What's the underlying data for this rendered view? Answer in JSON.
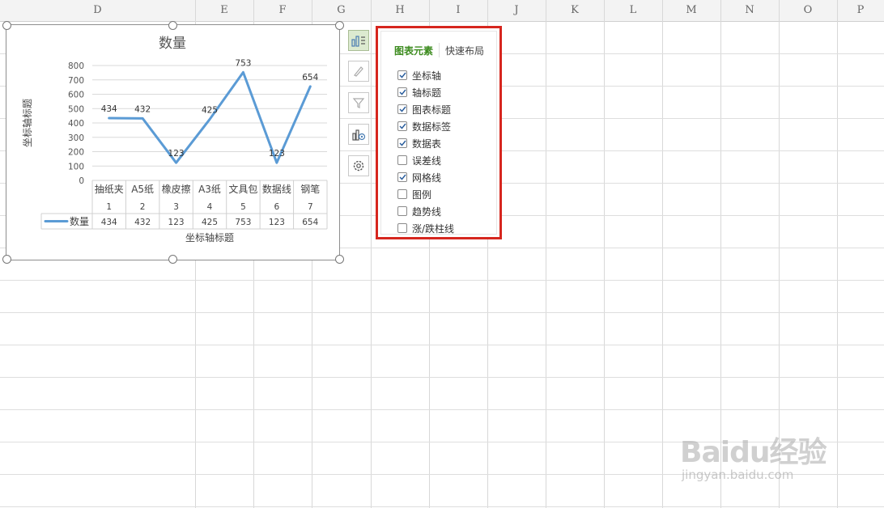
{
  "columns": [
    "D",
    "E",
    "F",
    "G",
    "H",
    "I",
    "J",
    "K",
    "L",
    "M",
    "N",
    "O",
    "P"
  ],
  "chart_data": {
    "type": "line",
    "title": "数量",
    "xlabel": "坐标轴标题",
    "ylabel": "坐标轴标题",
    "ylim": [
      0,
      800
    ],
    "yticks": [
      "0",
      "100",
      "200",
      "300",
      "400",
      "500",
      "600",
      "700",
      "800"
    ],
    "categories": [
      "抽纸夹",
      "A5纸",
      "橡皮擦",
      "A3纸",
      "文具包",
      "数据线",
      "钢笔"
    ],
    "category_numbers": [
      "1",
      "2",
      "3",
      "4",
      "5",
      "6",
      "7"
    ],
    "series": [
      {
        "name": "数量",
        "values": [
          434,
          432,
          123,
          425,
          753,
          123,
          654
        ]
      }
    ],
    "data_labels": [
      "434",
      "432",
      "123",
      "425",
      "753",
      "123",
      "654"
    ],
    "table_values": [
      "434",
      "432",
      "123",
      "425",
      "753",
      "123",
      "654"
    ],
    "line_color": "#5b9bd5",
    "grid": true
  },
  "tools": [
    {
      "icon": "chart-elements-icon",
      "active": true
    },
    {
      "icon": "brush-icon",
      "active": false
    },
    {
      "icon": "filter-icon",
      "active": false
    },
    {
      "icon": "chart-settings-icon",
      "active": false
    },
    {
      "icon": "gear-icon",
      "active": false
    }
  ],
  "panel": {
    "tab_elements": "图表元素",
    "tab_layout": "快速布局",
    "options": [
      {
        "label": "坐标轴",
        "checked": true
      },
      {
        "label": "轴标题",
        "checked": true
      },
      {
        "label": "图表标题",
        "checked": true
      },
      {
        "label": "数据标签",
        "checked": true
      },
      {
        "label": "数据表",
        "checked": true
      },
      {
        "label": "误差线",
        "checked": false
      },
      {
        "label": "网格线",
        "checked": true
      },
      {
        "label": "图例",
        "checked": false
      },
      {
        "label": "趋势线",
        "checked": false
      },
      {
        "label": "涨/跌柱线",
        "checked": false
      }
    ],
    "highlight_color": "#d6261e"
  },
  "watermark": {
    "brand": "Baidu经验",
    "url": "jingyan.baidu.com"
  }
}
